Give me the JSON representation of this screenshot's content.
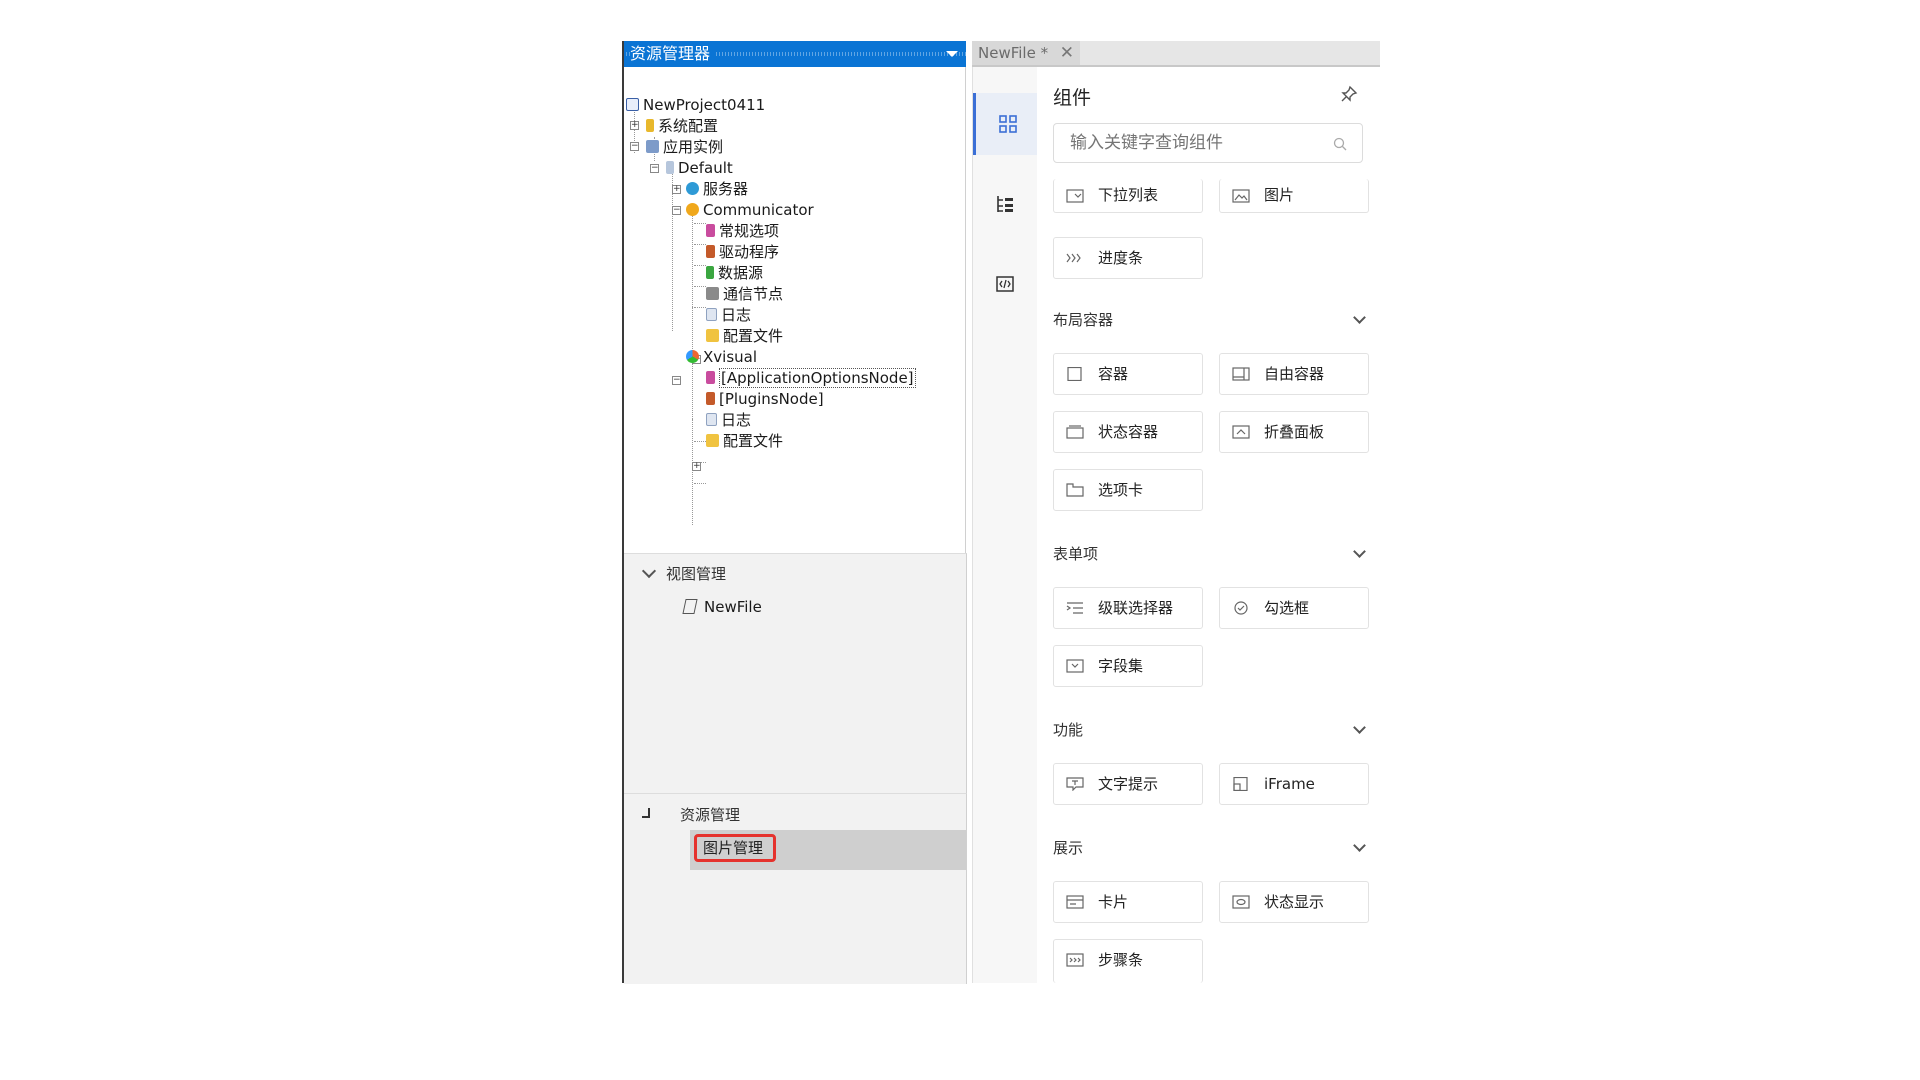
{
  "explorer": {
    "title": "资源管理器",
    "tree": [
      {
        "label": "NewProject0411"
      },
      {
        "label": "系统配置"
      },
      {
        "label": "应用实例"
      },
      {
        "label": "Default"
      },
      {
        "label": "服务器"
      },
      {
        "label": "Communicator"
      },
      {
        "label": "常规选项"
      },
      {
        "label": "驱动程序"
      },
      {
        "label": "数据源"
      },
      {
        "label": "通信节点"
      },
      {
        "label": "日志"
      },
      {
        "label": "配置文件"
      },
      {
        "label": "Xvisual"
      },
      {
        "label": "[ApplicationOptionsNode]"
      },
      {
        "label": "[PluginsNode]"
      },
      {
        "label": "日志"
      },
      {
        "label": "配置文件"
      }
    ],
    "view_section": {
      "title": "视图管理",
      "item": "NewFile"
    },
    "resource_section": {
      "title": "资源管理",
      "item": "图片管理"
    }
  },
  "editor": {
    "tab_label": "NewFile *",
    "tab_close": "✕"
  },
  "components": {
    "title": "组件",
    "search_placeholder": "输入关键字查询组件",
    "top_items": [
      "下拉列表",
      "图片",
      "进度条"
    ],
    "categories": [
      {
        "name": "布局容器",
        "items": [
          "容器",
          "自由容器",
          "状态容器",
          "折叠面板",
          "选项卡"
        ]
      },
      {
        "name": "表单项",
        "items": [
          "级联选择器",
          "勾选框",
          "字段集"
        ]
      },
      {
        "name": "功能",
        "items": [
          "文字提示",
          "iFrame"
        ]
      },
      {
        "name": "展示",
        "items": [
          "卡片",
          "状态显示",
          "步骤条"
        ]
      }
    ]
  },
  "colors": {
    "accent": "#0a74d4",
    "highlight": "#e5322d",
    "active_tab": "#3b6fd6"
  }
}
